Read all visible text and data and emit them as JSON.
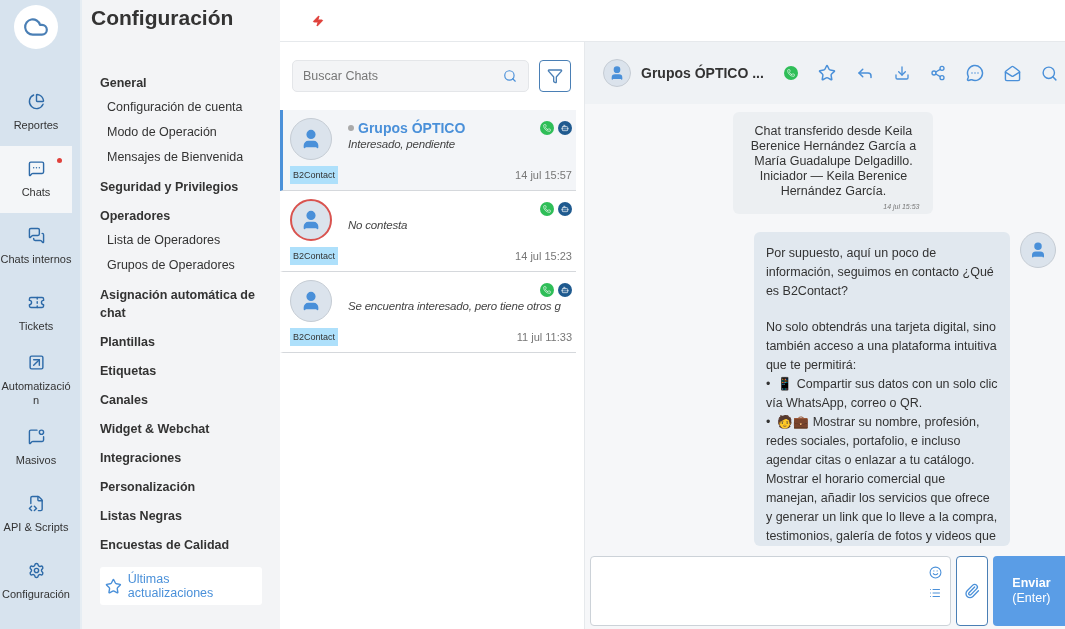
{
  "nav": {
    "items": [
      {
        "label": "Reportes",
        "selected": false,
        "unread": false
      },
      {
        "label": "Chats",
        "selected": true,
        "unread": true
      },
      {
        "label": "Chats internos",
        "selected": false,
        "unread": false
      },
      {
        "label": "Tickets",
        "selected": false,
        "unread": false
      },
      {
        "label": "Automatización",
        "selected": false,
        "unread": false
      },
      {
        "label": "Masivos",
        "selected": false,
        "unread": false
      },
      {
        "label": "API & Scripts",
        "selected": false,
        "unread": false
      },
      {
        "label": "Configuración",
        "selected": false,
        "unread": false
      }
    ]
  },
  "settings": {
    "title": "Configuración",
    "sections": [
      {
        "label": "General",
        "children": [
          {
            "label": "Configuración de cuenta"
          },
          {
            "label": "Modo de Operación"
          },
          {
            "label": "Mensajes de Bienvenida"
          }
        ]
      },
      {
        "label": "Seguridad y Privilegios"
      },
      {
        "label": "Operadores",
        "children": [
          {
            "label": "Lista de Operadores"
          },
          {
            "label": "Grupos de Operadores"
          }
        ]
      },
      {
        "label": "Asignación automática de chat"
      },
      {
        "label": "Plantillas"
      },
      {
        "label": "Etiquetas"
      },
      {
        "label": "Canales"
      },
      {
        "label": "Widget & Webchat"
      },
      {
        "label": "Integraciones"
      },
      {
        "label": "Personalización"
      },
      {
        "label": "Listas Negras"
      },
      {
        "label": "Encuestas de Calidad"
      }
    ],
    "updates_link": "Últimas actualizaciones"
  },
  "search": {
    "placeholder": "Buscar Chats"
  },
  "chats": [
    {
      "name": "Grupos ÓPTICO",
      "snippet": "Interesado, pendiente",
      "tag": "B2Contact",
      "time": "14 jul 15:57",
      "selected": true,
      "alert": false
    },
    {
      "snippet": "No contesta",
      "tag": "B2Contact",
      "time": "14 jul 15:23",
      "selected": false,
      "alert": true
    },
    {
      "snippet": "Se encuentra interesado, pero tiene otros g",
      "tag": "B2Contact",
      "time": "11 jul 11:33",
      "selected": false,
      "alert": false
    }
  ],
  "conversation": {
    "title": "Grupos ÓPTICO ...",
    "system_message": {
      "text": "Chat transferido desde Keila Berenice Hernández García a María Guadalupe Delgadillo. Iniciador — Keila Berenice Hernández García.",
      "time": "14 jul 15:53"
    },
    "message": {
      "paragraphs": [
        "Por supuesto, aquí un poco de información, seguimos en contacto ¿Qué es B2Contact?",
        "No solo obtendrás una tarjeta digital, sino también acceso a una plataforma intuitiva que te permitirá:\n•  📱 Compartir sus datos con un solo clic vía WhatsApp, correo o QR.\n•  🧑💼 Mostrar su nombre, profesión, redes sociales, portafolio, e incluso agendar citas o enlazar a tu catálogo. Mostrar el horario comercial que manejan, añadir los servicios que ofrece y generar un link que lo lleve a la compra, testimonios, galería de fotos y videos que"
      ]
    },
    "send_button": {
      "label": "Enviar",
      "hint": "(Enter)"
    }
  }
}
